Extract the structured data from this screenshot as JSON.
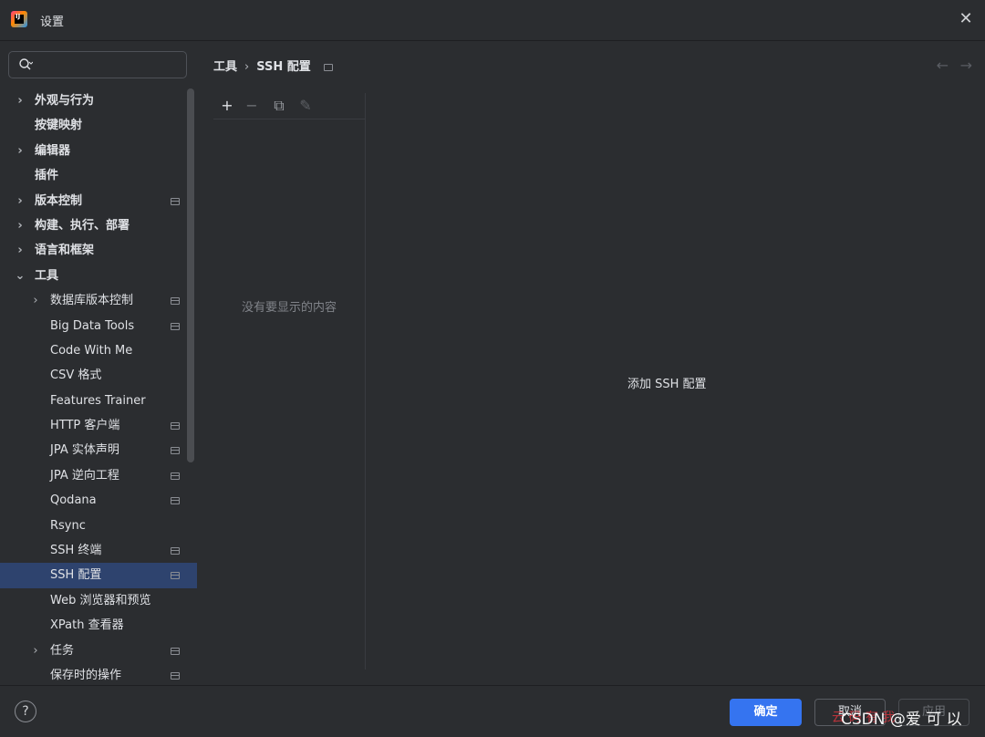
{
  "window": {
    "title": "设置",
    "close_glyph": "✕",
    "logo_text": "IJ"
  },
  "search": {
    "value": "",
    "placeholder": ""
  },
  "tree": [
    {
      "label": "外观与行为",
      "level": 0,
      "expandable": true,
      "expanded": false,
      "badge": false,
      "bold": true
    },
    {
      "label": "按键映射",
      "level": 0,
      "expandable": false,
      "badge": false,
      "bold": true
    },
    {
      "label": "编辑器",
      "level": 0,
      "expandable": true,
      "expanded": false,
      "badge": false,
      "bold": true
    },
    {
      "label": "插件",
      "level": 0,
      "expandable": false,
      "badge": false,
      "bold": true
    },
    {
      "label": "版本控制",
      "level": 0,
      "expandable": true,
      "expanded": false,
      "badge": true,
      "bold": true
    },
    {
      "label": "构建、执行、部署",
      "level": 0,
      "expandable": true,
      "expanded": false,
      "badge": false,
      "bold": true
    },
    {
      "label": "语言和框架",
      "level": 0,
      "expandable": true,
      "expanded": false,
      "badge": false,
      "bold": true
    },
    {
      "label": "工具",
      "level": 0,
      "expandable": true,
      "expanded": true,
      "badge": false,
      "bold": true
    },
    {
      "label": "数据库版本控制",
      "level": 1,
      "expandable": true,
      "expanded": false,
      "badge": true
    },
    {
      "label": "Big Data Tools",
      "level": 1,
      "expandable": false,
      "badge": true
    },
    {
      "label": "Code With Me",
      "level": 1,
      "expandable": false,
      "badge": false
    },
    {
      "label": "CSV 格式",
      "level": 1,
      "expandable": false,
      "badge": false
    },
    {
      "label": "Features Trainer",
      "level": 1,
      "expandable": false,
      "badge": false
    },
    {
      "label": "HTTP 客户端",
      "level": 1,
      "expandable": false,
      "badge": true
    },
    {
      "label": "JPA 实体声明",
      "level": 1,
      "expandable": false,
      "badge": true
    },
    {
      "label": "JPA 逆向工程",
      "level": 1,
      "expandable": false,
      "badge": true
    },
    {
      "label": "Qodana",
      "level": 1,
      "expandable": false,
      "badge": true
    },
    {
      "label": "Rsync",
      "level": 1,
      "expandable": false,
      "badge": false
    },
    {
      "label": "SSH 终端",
      "level": 1,
      "expandable": false,
      "badge": true
    },
    {
      "label": "SSH 配置",
      "level": 1,
      "expandable": false,
      "badge": true,
      "selected": true
    },
    {
      "label": "Web 浏览器和预览",
      "level": 1,
      "expandable": false,
      "badge": false
    },
    {
      "label": "XPath 查看器",
      "level": 1,
      "expandable": false,
      "badge": false
    },
    {
      "label": "任务",
      "level": 1,
      "expandable": true,
      "expanded": false,
      "badge": true
    },
    {
      "label": "保存时的操作",
      "level": 1,
      "expandable": false,
      "badge": true
    }
  ],
  "breadcrumb": {
    "parent": "工具",
    "separator": "›",
    "current": "SSH 配置"
  },
  "nav": {
    "back": "←",
    "forward": "→"
  },
  "toolbar": {
    "add": "+",
    "remove": "−",
    "copy": "⧉",
    "edit": "✎"
  },
  "list_panel": {
    "empty_text": "没有要显示的内容"
  },
  "detail": {
    "text": "添加 SSH 配置"
  },
  "footer": {
    "help": "?",
    "ok_label": "确定",
    "cancel_label": "取消",
    "apply_label": "应用",
    "watermark": "CSDN @爱 可 以",
    "watermark_red": "云 码 有 我"
  },
  "colors": {
    "accent": "#3574f0",
    "selection": "#2e436e",
    "background": "#2b2d30"
  }
}
